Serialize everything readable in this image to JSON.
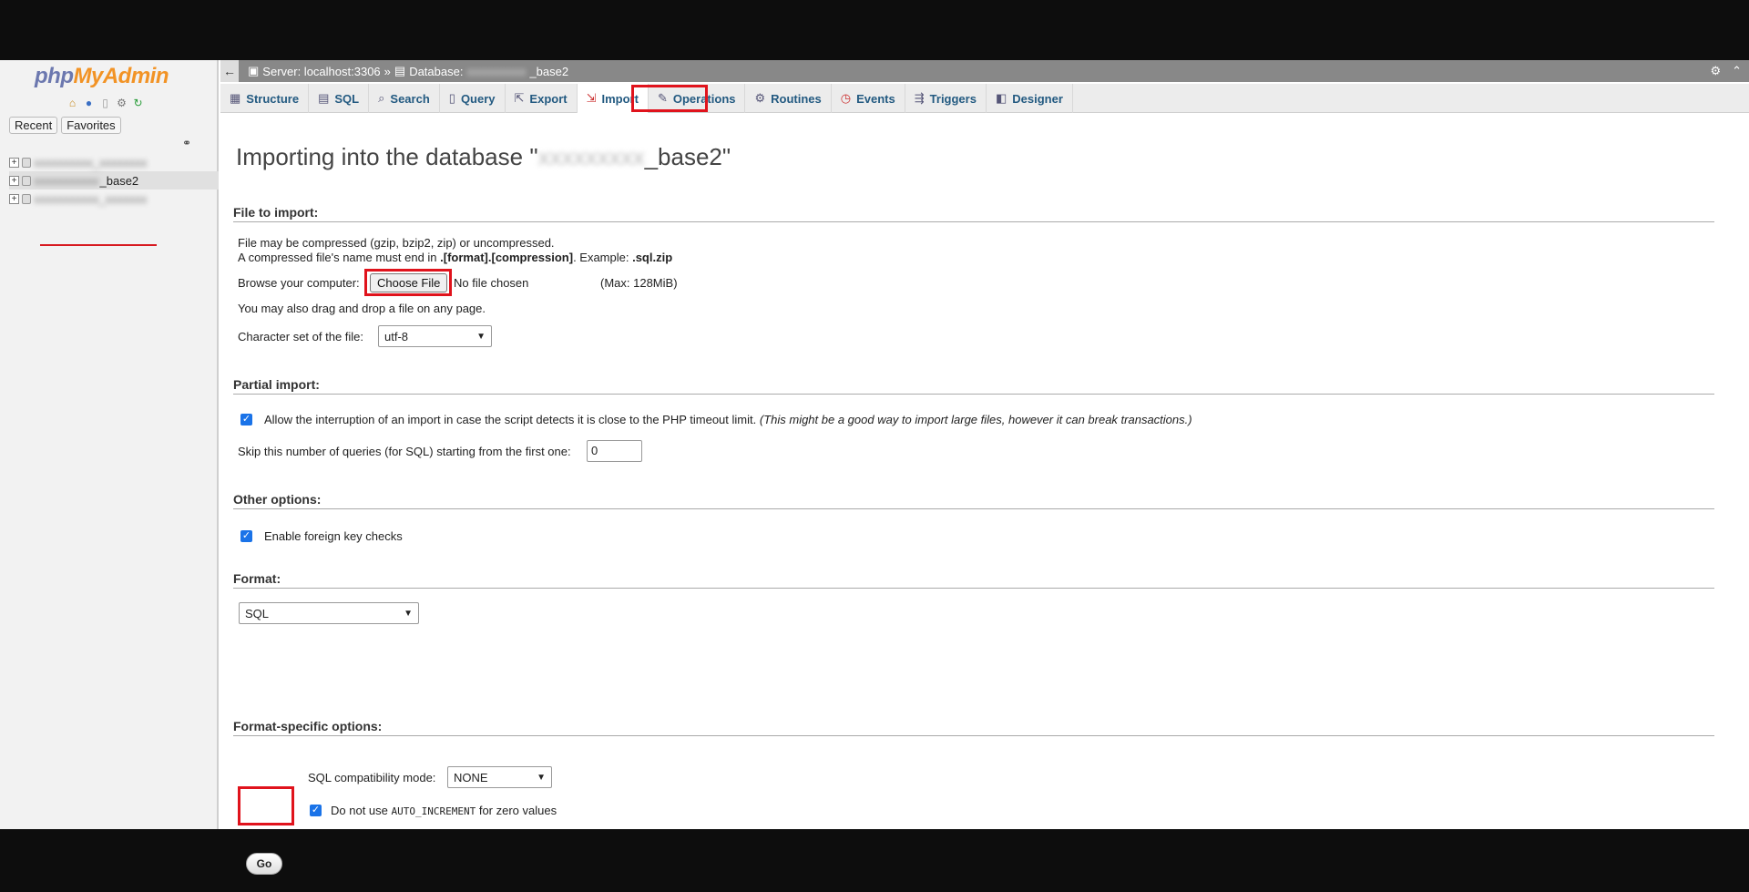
{
  "sidebar": {
    "logo_php": "php",
    "logo_myadmin": "MyAdmin",
    "nav_icons": [
      "home-icon",
      "help-icon",
      "docs-icon",
      "settings-icon",
      "reload-icon"
    ],
    "recent_label": "Recent",
    "favorites_label": "Favorites",
    "databases": [
      {
        "prefix": "",
        "name": "",
        "selected": false
      },
      {
        "prefix": "",
        "name": "_base2",
        "selected": true
      },
      {
        "prefix": "",
        "name": "",
        "selected": false
      }
    ]
  },
  "topbar": {
    "back_label": "←",
    "server_label": "Server: localhost:3306",
    "separator": "»",
    "database_label": "Database:",
    "database_name": "_base2"
  },
  "tabs": [
    {
      "label": "Structure",
      "icon": "structure-icon"
    },
    {
      "label": "SQL",
      "icon": "sql-icon"
    },
    {
      "label": "Search",
      "icon": "search-icon"
    },
    {
      "label": "Query",
      "icon": "query-icon"
    },
    {
      "label": "Export",
      "icon": "export-icon"
    },
    {
      "label": "Import",
      "icon": "import-icon",
      "active": true
    },
    {
      "label": "Operations",
      "icon": "wrench-icon"
    },
    {
      "label": "Routines",
      "icon": "routines-icon"
    },
    {
      "label": "Events",
      "icon": "clock-icon"
    },
    {
      "label": "Triggers",
      "icon": "triggers-icon"
    },
    {
      "label": "Designer",
      "icon": "designer-icon"
    }
  ],
  "page": {
    "title_prefix": "Importing into the database \"",
    "title_suffix": "_base2\""
  },
  "file_section": {
    "heading": "File to import:",
    "line1": "File may be compressed (gzip, bzip2, zip) or uncompressed.",
    "line2_a": "A compressed file's name must end in ",
    "line2_b": ".[format].[compression]",
    "line2_c": ". Example: ",
    "line2_d": ".sql.zip",
    "browse_label": "Browse your computer:",
    "choose_file": "Choose File",
    "no_file": "No file chosen",
    "max_size": "(Max: 128MiB)",
    "drag_hint": "You may also drag and drop a file on any page.",
    "charset_label": "Character set of the file:",
    "charset_value": "utf-8"
  },
  "partial_section": {
    "heading": "Partial import:",
    "allow_interrupt": "Allow the interruption of an import in case the script detects it is close to the PHP timeout limit.",
    "allow_interrupt_note": "(This might be a good way to import large files, however it can break transactions.)",
    "allow_interrupt_checked": true,
    "skip_label": "Skip this number of queries (for SQL) starting from the first one:",
    "skip_value": "0"
  },
  "other_section": {
    "heading": "Other options:",
    "foreign_keys": "Enable foreign key checks",
    "foreign_keys_checked": true
  },
  "format_section": {
    "heading": "Format:",
    "format_value": "SQL"
  },
  "format_specific": {
    "heading": "Format-specific options:",
    "compat_label": "SQL compatibility mode:",
    "compat_value": "NONE",
    "auto_inc_a": "Do not use ",
    "auto_inc_code": "AUTO_INCREMENT",
    "auto_inc_b": " for zero values",
    "auto_inc_checked": true
  },
  "go_label": "Go"
}
